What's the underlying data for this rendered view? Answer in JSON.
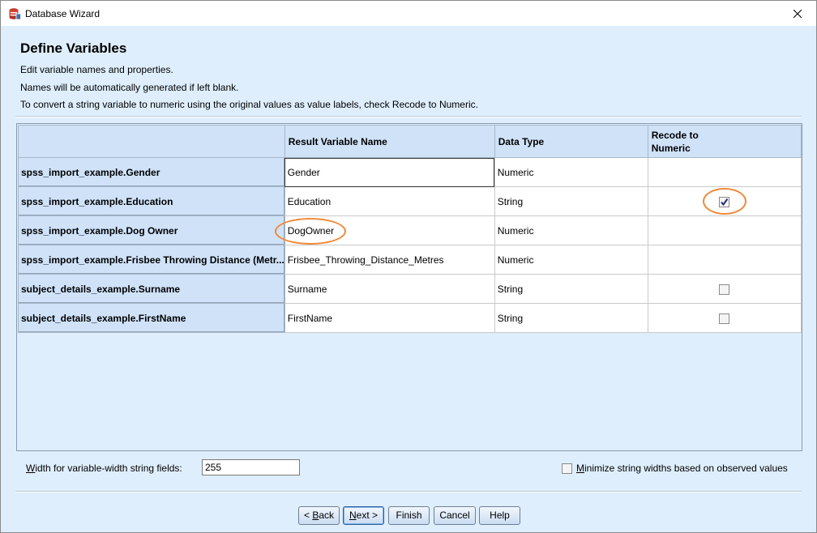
{
  "window": {
    "title": "Database Wizard"
  },
  "page": {
    "heading": "Define Variables",
    "desc1": "Edit variable names and properties.",
    "desc2": "Names will be automatically generated if left blank.",
    "desc3": "To convert a string variable to numeric using the original values as value labels, check Recode to Numeric."
  },
  "grid": {
    "columns": [
      "",
      "Result Variable Name",
      "Data Type",
      "Recode to Numeric"
    ],
    "recode_line1": "Recode to",
    "recode_line2": "Numeric",
    "rows": [
      {
        "source": "spss_import_example.Gender",
        "name": "Gender",
        "type": "Numeric",
        "recode": null
      },
      {
        "source": "spss_import_example.Education",
        "name": "Education",
        "type": "String",
        "recode": true
      },
      {
        "source": "spss_import_example.Dog Owner",
        "name": "DogOwner",
        "type": "Numeric",
        "recode": null
      },
      {
        "source": "spss_import_example.Frisbee Throwing Distance (Metr...",
        "name": "Frisbee_Throwing_Distance_Metres",
        "type": "Numeric",
        "recode": null
      },
      {
        "source": "subject_details_example.Surname",
        "name": "Surname",
        "type": "String",
        "recode": false
      },
      {
        "source": "subject_details_example.FirstName",
        "name": "FirstName",
        "type": "String",
        "recode": false
      }
    ]
  },
  "options": {
    "width_label_first": "W",
    "width_label_rest": "idth for variable-width string fields:",
    "width_value": "255",
    "minimize_label_first": "M",
    "minimize_label_rest": "inimize string widths based on observed values",
    "minimize_checked": false
  },
  "buttons": {
    "back_prefix": "< ",
    "back_key": "B",
    "back_rest": "ack",
    "next_key": "N",
    "next_rest": "ext >",
    "finish": "Finish",
    "cancel": "Cancel",
    "help": "Help"
  },
  "colors": {
    "highlight_ring": "#ef8a3a",
    "header_bg": "#cfe2f8",
    "window_bg": "#dfeefc"
  },
  "icons": {
    "app": "database-wizard-icon",
    "close": "close-icon",
    "check": "checkmark-icon"
  }
}
